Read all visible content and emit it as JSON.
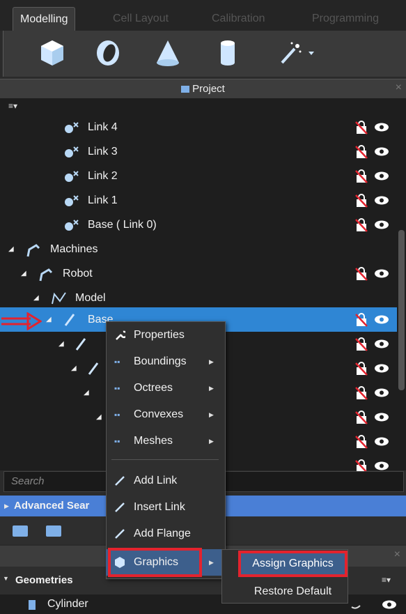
{
  "tabs": [
    {
      "label": "Modelling",
      "active": true
    },
    {
      "label": "Cell Layout",
      "active": false
    },
    {
      "label": "Calibration",
      "active": false
    },
    {
      "label": "Programming",
      "active": false
    }
  ],
  "toolbar": {
    "icons": [
      "cube-icon",
      "disc-icon",
      "cone-icon",
      "cylinder-icon",
      "magic-wand-icon"
    ]
  },
  "project_panel": {
    "title": "Project",
    "close": "×",
    "menu": "≡▾"
  },
  "tree": {
    "links": [
      "Link 4",
      "Link 3",
      "Link 2",
      "Link 1",
      "Base ( Link 0)"
    ],
    "machines": "Machines",
    "robot": "Robot",
    "model": "Model",
    "selected": "Base"
  },
  "search": {
    "placeholder": "Search"
  },
  "advanced_search": {
    "label": "Advanced Sear"
  },
  "context_menu": {
    "items": [
      {
        "label": "Properties",
        "submenu": false
      },
      {
        "label": "Boundings",
        "submenu": true
      },
      {
        "label": "Octrees",
        "submenu": true
      },
      {
        "label": "Convexes",
        "submenu": true
      },
      {
        "label": "Meshes",
        "submenu": true
      },
      {
        "label": "Add Link",
        "submenu": false
      },
      {
        "label": "Insert Link",
        "submenu": false
      },
      {
        "label": "Add Flange",
        "submenu": false
      },
      {
        "label": "Graphics",
        "submenu": true
      }
    ]
  },
  "submenu": {
    "items": [
      "Assign Graphics",
      "Restore Default"
    ]
  },
  "geometries": {
    "title": "Geometries",
    "items": [
      "Cylinder"
    ]
  },
  "colors": {
    "selection": "#2f86d4",
    "highlight": "#e3232e",
    "menu_hover": "#3d5f8c"
  }
}
